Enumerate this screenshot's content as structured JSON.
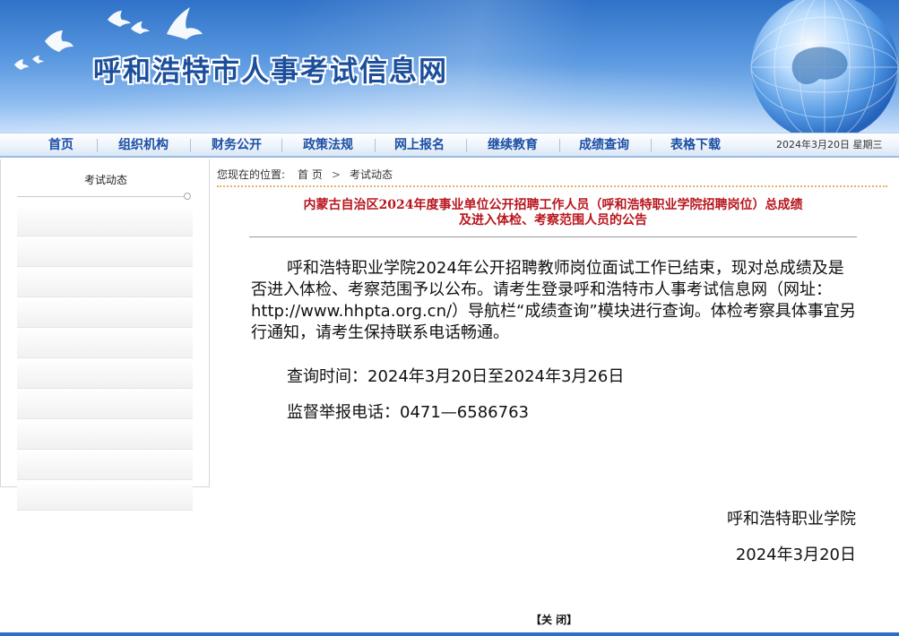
{
  "header": {
    "site_title": "呼和浩特市人事考试信息网"
  },
  "nav": {
    "items": [
      {
        "label": "首页"
      },
      {
        "label": "组织机构"
      },
      {
        "label": "财务公开"
      },
      {
        "label": "政策法规"
      },
      {
        "label": "网上报名"
      },
      {
        "label": "继续教育"
      },
      {
        "label": "成绩查询"
      },
      {
        "label": "表格下载"
      }
    ],
    "date": "2024年3月20日  星期三"
  },
  "sidebar": {
    "title": "考试动态"
  },
  "breadcrumb": {
    "prefix": "您现在的位置:",
    "home": "首 页",
    "separator": ">",
    "current": "考试动态"
  },
  "article": {
    "title_line1": "内蒙古自治区2024年度事业单位公开招聘工作人员（呼和浩特职业学院招聘岗位）总成绩",
    "title_line2": "及进入体检、考察范围人员的公告",
    "body": "呼和浩特职业学院2024年公开招聘教师岗位面试工作已结束，现对总成绩及是否进入体检、考察范围予以公布。请考生登录呼和浩特市人事考试信息网（网址：http://www.hhpta.org.cn/）导航栏“成绩查询”模块进行查询。体检考察具体事宜另行通知，请考生保持联系电话畅通。",
    "query_time": "查询时间：2024年3月20日至2024年3月26日",
    "hotline": "监督举报电话：0471—6586763",
    "signature_org": "呼和浩特职业学院",
    "signature_date": "2024年3月20日"
  },
  "footer": {
    "close_label": "【关 闭】"
  }
}
